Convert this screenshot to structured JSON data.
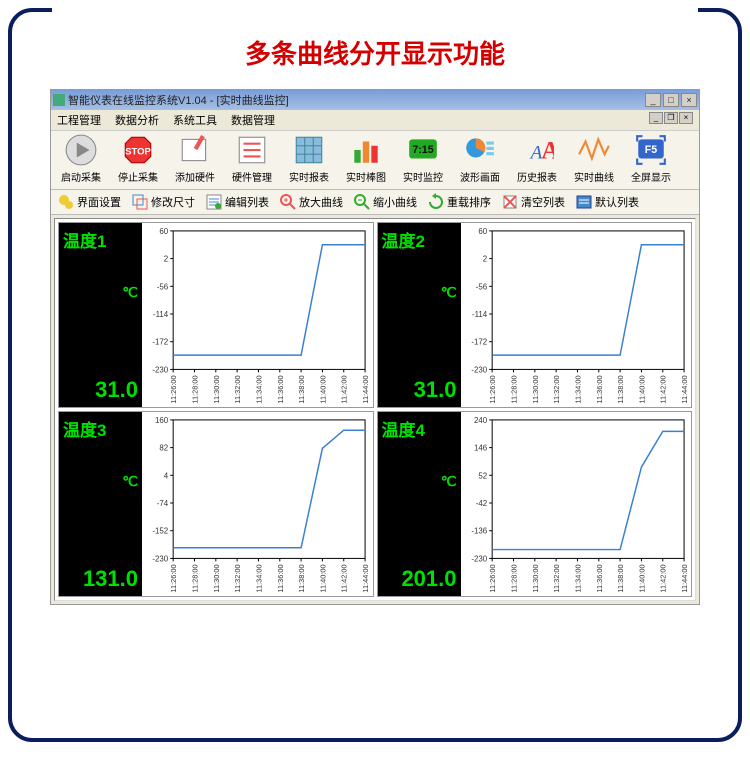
{
  "caption": "多条曲线分开显示功能",
  "window": {
    "title": "智能仪表在线监控系统V1.04 - [实时曲线监控]"
  },
  "menu": [
    "工程管理",
    "数据分析",
    "系统工具",
    "数据管理"
  ],
  "toolbar1": [
    {
      "label": "启动采集",
      "icon": "play"
    },
    {
      "label": "停止采集",
      "icon": "stop"
    },
    {
      "label": "添加硬件",
      "icon": "edit"
    },
    {
      "label": "硬件管理",
      "icon": "list"
    },
    {
      "label": "实时报表",
      "icon": "grid"
    },
    {
      "label": "实时棒图",
      "icon": "bars"
    },
    {
      "label": "实时监控",
      "icon": "clock"
    },
    {
      "label": "波形画面",
      "icon": "pie"
    },
    {
      "label": "历史报表",
      "icon": "font"
    },
    {
      "label": "实时曲线",
      "icon": "wave"
    },
    {
      "label": "全屏显示",
      "icon": "f5"
    }
  ],
  "toolbar2": [
    {
      "label": "界面设置",
      "icon": "gears"
    },
    {
      "label": "修改尺寸",
      "icon": "resize"
    },
    {
      "label": "编辑列表",
      "icon": "editlist"
    },
    {
      "label": "放大曲线",
      "icon": "zoomin"
    },
    {
      "label": "缩小曲线",
      "icon": "zoomout"
    },
    {
      "label": "重载排序",
      "icon": "reload"
    },
    {
      "label": "清空列表",
      "icon": "clear"
    },
    {
      "label": "默认列表",
      "icon": "default"
    }
  ],
  "panels": [
    {
      "title": "温度1",
      "unit": "℃",
      "value": "31.0",
      "ymin": -230,
      "ymax": 60,
      "yticks": [
        60,
        2,
        -56,
        -114,
        -172,
        -230
      ]
    },
    {
      "title": "温度2",
      "unit": "℃",
      "value": "31.0",
      "ymin": -230,
      "ymax": 60,
      "yticks": [
        60,
        2,
        -56,
        -114,
        -172,
        -230
      ]
    },
    {
      "title": "温度3",
      "unit": "℃",
      "value": "131.0",
      "ymin": -230,
      "ymax": 160,
      "yticks": [
        160,
        82,
        4,
        -74,
        -152,
        -230
      ]
    },
    {
      "title": "温度4",
      "unit": "℃",
      "value": "201.0",
      "ymin": -230,
      "ymax": 240,
      "yticks": [
        240,
        146,
        52,
        -42,
        -136,
        -230
      ]
    }
  ],
  "xticks": [
    "11:26:00",
    "11:28:00",
    "11:30:00",
    "11:32:00",
    "11:34:00",
    "11:36:00",
    "11:38:00",
    "11:40:00",
    "11:42:00",
    "11:44:00"
  ],
  "chart_data": [
    {
      "type": "line",
      "title": "温度1",
      "ylabel": "℃",
      "x": [
        "11:26:00",
        "11:28:00",
        "11:30:00",
        "11:32:00",
        "11:34:00",
        "11:36:00",
        "11:38:00",
        "11:40:00",
        "11:42:00",
        "11:44:00"
      ],
      "y": [
        -200,
        -200,
        -200,
        -200,
        -200,
        -200,
        -200,
        31,
        31,
        31
      ],
      "ylim": [
        -230,
        60
      ]
    },
    {
      "type": "line",
      "title": "温度2",
      "ylabel": "℃",
      "x": [
        "11:26:00",
        "11:28:00",
        "11:30:00",
        "11:32:00",
        "11:34:00",
        "11:36:00",
        "11:38:00",
        "11:40:00",
        "11:42:00",
        "11:44:00"
      ],
      "y": [
        -200,
        -200,
        -200,
        -200,
        -200,
        -200,
        -200,
        31,
        31,
        31
      ],
      "ylim": [
        -230,
        60
      ]
    },
    {
      "type": "line",
      "title": "温度3",
      "ylabel": "℃",
      "x": [
        "11:26:00",
        "11:28:00",
        "11:30:00",
        "11:32:00",
        "11:34:00",
        "11:36:00",
        "11:38:00",
        "11:40:00",
        "11:42:00",
        "11:44:00"
      ],
      "y": [
        -200,
        -200,
        -200,
        -200,
        -200,
        -200,
        -200,
        80,
        131,
        131
      ],
      "ylim": [
        -230,
        160
      ]
    },
    {
      "type": "line",
      "title": "温度4",
      "ylabel": "℃",
      "x": [
        "11:26:00",
        "11:28:00",
        "11:30:00",
        "11:32:00",
        "11:34:00",
        "11:36:00",
        "11:38:00",
        "11:40:00",
        "11:42:00",
        "11:44:00"
      ],
      "y": [
        -200,
        -200,
        -200,
        -200,
        -200,
        -200,
        -200,
        80,
        201,
        201
      ],
      "ylim": [
        -230,
        240
      ]
    }
  ]
}
